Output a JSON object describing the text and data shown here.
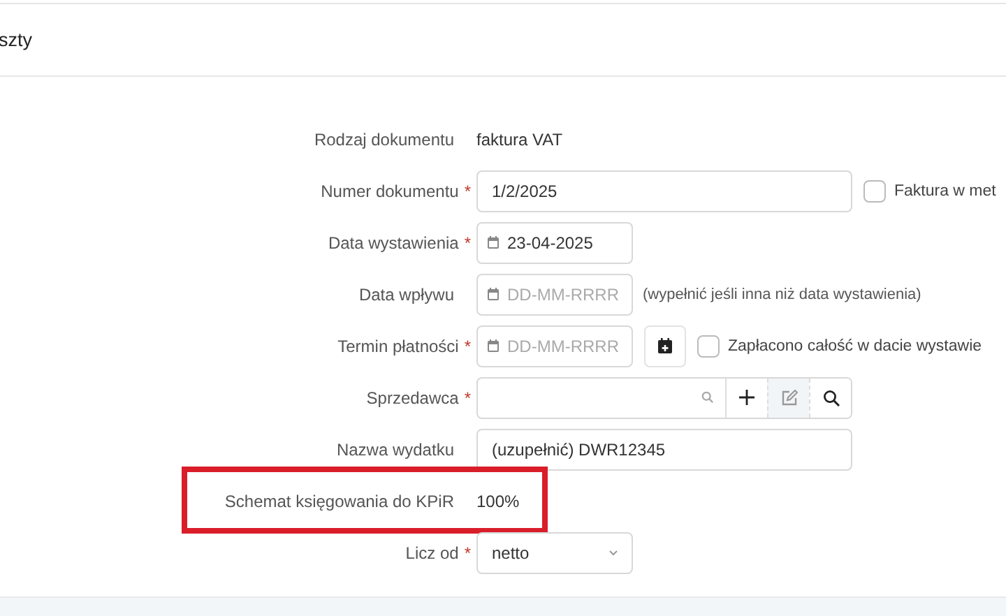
{
  "panel": {
    "title": "szty"
  },
  "rows": [
    {
      "kind": "text",
      "label": "Rodzaj dokumentu",
      "value": "faktura VAT"
    },
    {
      "kind": "input",
      "label": "Numer dokumentu",
      "required_mark": "*",
      "value": "1/2/2025",
      "checkbox": {
        "label": "Faktura w met",
        "checked": false
      }
    },
    {
      "kind": "date",
      "label": "Data wystawienia",
      "required_mark": "*",
      "value": "23-04-2025"
    },
    {
      "kind": "date",
      "label": "Data wpływu",
      "placeholder": "DD-MM-RRRR",
      "note": "(wypełnić jeśli inna niż data wystawienia)"
    },
    {
      "kind": "date",
      "label": "Termin płatności",
      "required_mark": "*",
      "placeholder": "DD-MM-RRRR",
      "calendar_button": true,
      "checkbox": {
        "label": "Zapłacono całość w dacie wystawie",
        "checked": false
      }
    },
    {
      "kind": "lookup",
      "label": "Sprzedawca",
      "required_mark": "*"
    },
    {
      "kind": "input",
      "label": "Nazwa wydatku",
      "value": "(uzupełnić) DWR12345"
    },
    {
      "kind": "text",
      "label": "Schemat księgowania do KPiR",
      "value": "100%",
      "highlighted": true
    },
    {
      "kind": "select",
      "label": "Licz od",
      "required_mark": "*",
      "value": "netto"
    }
  ]
}
